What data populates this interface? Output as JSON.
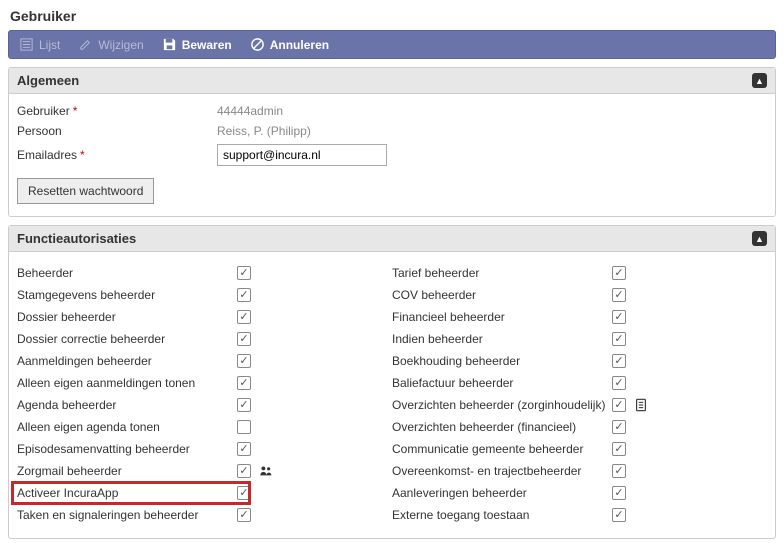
{
  "pageTitle": "Gebruiker",
  "toolbar": {
    "list": "Lijst",
    "edit": "Wijzigen",
    "save": "Bewaren",
    "cancel": "Annuleren"
  },
  "sections": {
    "general": {
      "title": "Algemeen",
      "fields": {
        "userLabel": "Gebruiker",
        "userValue": "44444admin",
        "personLabel": "Persoon",
        "personValue": "Reiss, P. (Philipp)",
        "emailLabel": "Emailadres",
        "emailValue": "support@incura.nl",
        "resetPassword": "Resetten wachtwoord"
      }
    },
    "auth": {
      "title": "Functieautorisaties",
      "left": [
        {
          "label": "Beheerder",
          "checked": true
        },
        {
          "label": "Stamgegevens beheerder",
          "checked": true
        },
        {
          "label": "Dossier beheerder",
          "checked": true
        },
        {
          "label": "Dossier correctie beheerder",
          "checked": true
        },
        {
          "label": "Aanmeldingen beheerder",
          "checked": true
        },
        {
          "label": "Alleen eigen aanmeldingen tonen",
          "checked": true
        },
        {
          "label": "Agenda beheerder",
          "checked": true
        },
        {
          "label": "Alleen eigen agenda tonen",
          "checked": false
        },
        {
          "label": "Episodesamenvatting beheerder",
          "checked": true
        },
        {
          "label": "Zorgmail beheerder",
          "checked": true,
          "icon": "people"
        },
        {
          "label": "Activeer IncuraApp",
          "checked": true,
          "highlight": true
        },
        {
          "label": "Taken en signaleringen beheerder",
          "checked": true
        }
      ],
      "right": [
        {
          "label": "Tarief beheerder",
          "checked": true
        },
        {
          "label": "COV beheerder",
          "checked": true
        },
        {
          "label": "Financieel beheerder",
          "checked": true
        },
        {
          "label": "Indien beheerder",
          "checked": true
        },
        {
          "label": "Boekhouding beheerder",
          "checked": true
        },
        {
          "label": "Baliefactuur beheerder",
          "checked": true
        },
        {
          "label": "Overzichten beheerder (zorginhoudelijk)",
          "checked": true,
          "icon": "doc"
        },
        {
          "label": "Overzichten beheerder (financieel)",
          "checked": true
        },
        {
          "label": "Communicatie gemeente beheerder",
          "checked": true
        },
        {
          "label": "Overeenkomst- en trajectbeheerder",
          "checked": true
        },
        {
          "label": "Aanleveringen beheerder",
          "checked": true
        },
        {
          "label": "Externe toegang toestaan",
          "checked": true
        }
      ]
    }
  }
}
